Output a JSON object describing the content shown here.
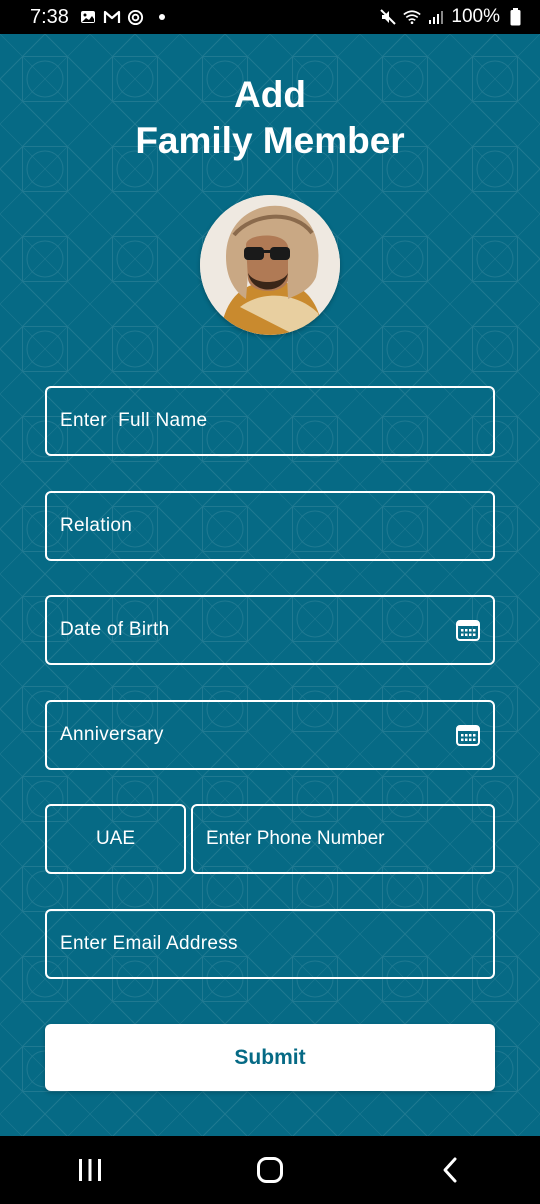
{
  "status_bar": {
    "time": "7:38",
    "battery": "100%",
    "left_icons": [
      "gallery-icon",
      "gmail-icon",
      "sync-icon"
    ],
    "right_icons": [
      "mute-icon",
      "wifi-icon",
      "signal-icon",
      "battery-icon"
    ]
  },
  "header": {
    "title_line1": "Add",
    "title_line2": "Family Member"
  },
  "form": {
    "full_name_placeholder": "Enter  Full Name",
    "relation_placeholder": "Relation",
    "dob_placeholder": "Date of Birth",
    "anniversary_placeholder": "Anniversary",
    "country_code": "UAE",
    "phone_placeholder": "Enter Phone Number",
    "email_placeholder": "Enter Email Address",
    "submit_label": "Submit"
  },
  "colors": {
    "background": "#066a85",
    "accent_text": "#066a85",
    "field_border": "#ffffff"
  },
  "nav_bar": {
    "icons": [
      "recent-apps-icon",
      "home-icon",
      "back-icon"
    ]
  }
}
